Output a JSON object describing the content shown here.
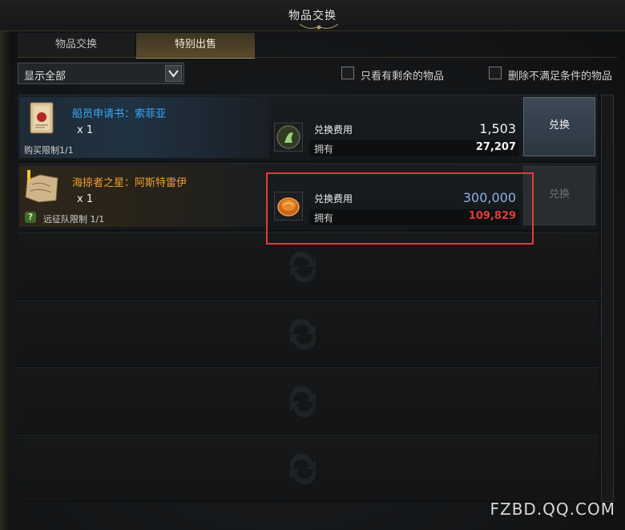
{
  "window": {
    "title": "物品交换"
  },
  "tabs": [
    {
      "label": "物品交换",
      "active": false
    },
    {
      "label": "特别出售",
      "active": true
    }
  ],
  "filter": {
    "selected": "显示全部",
    "options": [
      "显示全部"
    ]
  },
  "checkboxes": [
    {
      "label": "只看有剩余的物品",
      "checked": false
    },
    {
      "label": "删除不满足条件的物品",
      "checked": false
    }
  ],
  "items": [
    {
      "name": "船员申请书：索菲亚",
      "name_color": "#3aa8ff",
      "qty": "x 1",
      "limit": "购买限制1/1",
      "cost_label": "兑换费用",
      "cost_value": "1,503",
      "cost_value_color": "#f2f2f2",
      "owned_label": "拥有",
      "owned_value": "27,207",
      "owned_value_color": "#f2f2f2",
      "cost_icon": "green-emblem-icon",
      "button_label": "兑换",
      "button_enabled": true
    },
    {
      "name": "海掠者之星：阿斯特雷伊",
      "name_color": "#f0a030",
      "qty": "x 1",
      "limit": "远征队限制 1/1",
      "limit_icon": "?",
      "cost_label": "兑换费用",
      "cost_value": "300,000",
      "cost_value_color": "#8fb0e8",
      "owned_label": "拥有",
      "owned_value": "109,829",
      "owned_value_color": "#e83838",
      "cost_icon": "gold-coin-icon",
      "button_label": "兑换",
      "button_enabled": false
    }
  ],
  "empty_slot_count": 4,
  "highlight_color": "#e23a3a",
  "watermark": "FZBD.QQ.COM"
}
